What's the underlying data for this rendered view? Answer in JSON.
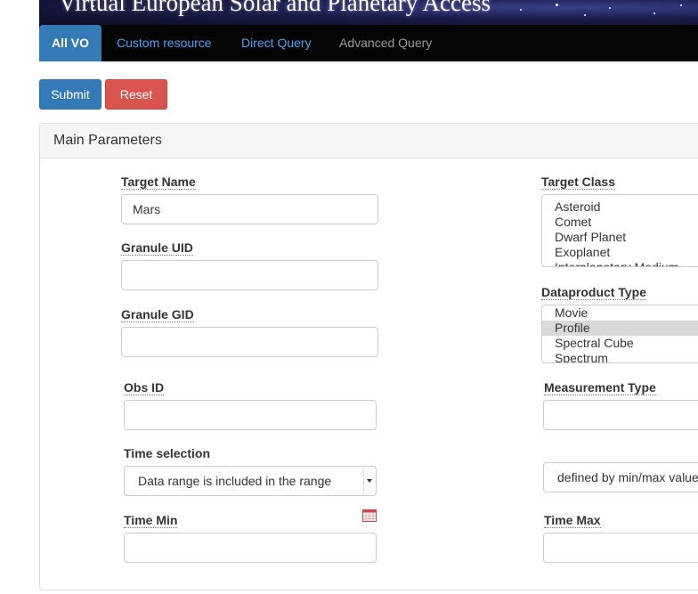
{
  "banner": {
    "title": "Virtual European Solar and Planetary Access"
  },
  "nav": {
    "tabs": [
      {
        "label": "All VO"
      },
      {
        "label": "Custom resource"
      },
      {
        "label": "Direct Query"
      },
      {
        "label": "Advanced Query"
      }
    ]
  },
  "actions": {
    "submit": "Submit",
    "reset": "Reset"
  },
  "panel": {
    "title": "Main Parameters"
  },
  "form": {
    "target_name": {
      "label": "Target Name",
      "value": "Mars"
    },
    "granule_uid": {
      "label": "Granule UID",
      "value": ""
    },
    "granule_gid": {
      "label": "Granule GID",
      "value": ""
    },
    "obs_id": {
      "label": "Obs ID",
      "value": ""
    },
    "time_selection": {
      "label": "Time selection",
      "value": "Data range is included in the range"
    },
    "time_min": {
      "label": "Time Min",
      "value": ""
    },
    "time_max": {
      "label": "Time Max",
      "value": ""
    },
    "target_class": {
      "label": "Target Class",
      "options": [
        "Asteroid",
        "Comet",
        "Dwarf Planet",
        "Exoplanet",
        "Interplanetary Medium"
      ]
    },
    "dataproduct_type": {
      "label": "Dataproduct Type",
      "options": [
        "Movie",
        "Profile",
        "Spectral Cube",
        "Spectrum"
      ],
      "selected": "Profile"
    },
    "measurement_type": {
      "label": "Measurement Type",
      "value": ""
    },
    "spectral_range_mode": {
      "value": "defined by min/max values"
    }
  },
  "colors": {
    "primary": "#337ab7",
    "danger": "#d9534f",
    "navbar": "#050505",
    "link": "#4aa3f0",
    "muted_link": "#9d9d9d"
  }
}
